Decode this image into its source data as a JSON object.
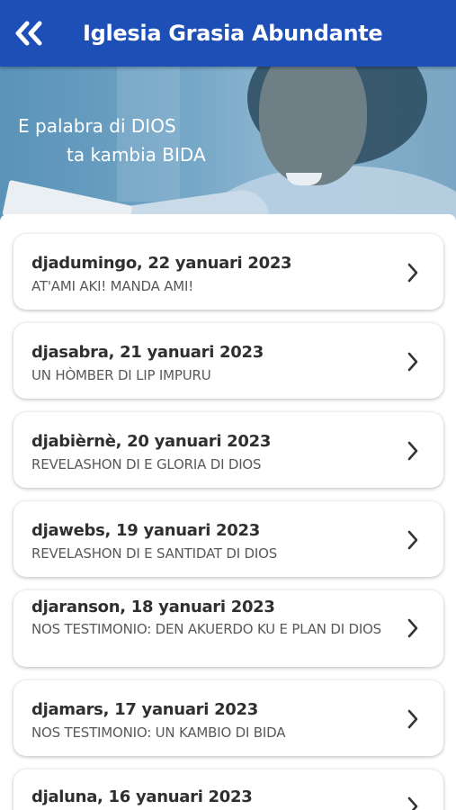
{
  "header": {
    "title": "Iglesia Grasia Abundante",
    "back_icon": "double-chevron-left-icon",
    "background_color": "#1d4fb6"
  },
  "banner": {
    "line1": "E palabra di DIOS",
    "line2": "ta kambia BIDA"
  },
  "devotionals": [
    {
      "date": "djadumingo, 22 yanuari 2023",
      "title": "AT'AMI AKI! MANDA AMI!"
    },
    {
      "date": "djasabra, 21 yanuari 2023",
      "title": "UN HÒMBER DI LIP IMPURU"
    },
    {
      "date": "djabièrnè, 20 yanuari 2023",
      "title": "REVELASHON DI E GLORIA DI DIOS"
    },
    {
      "date": "djawebs, 19 yanuari 2023",
      "title": "REVELASHON DI E SANTIDAT DI DIOS"
    },
    {
      "date": "djaranson, 18 yanuari 2023",
      "title": "NOS TESTIMONIO: DEN AKUERDO KU E PLAN DI DIOS"
    },
    {
      "date": "djamars, 17 yanuari 2023",
      "title": "NOS TESTIMONIO: UN KAMBIO DI BIDA"
    },
    {
      "date": "djaluna, 16 yanuari 2023",
      "title": ""
    }
  ]
}
